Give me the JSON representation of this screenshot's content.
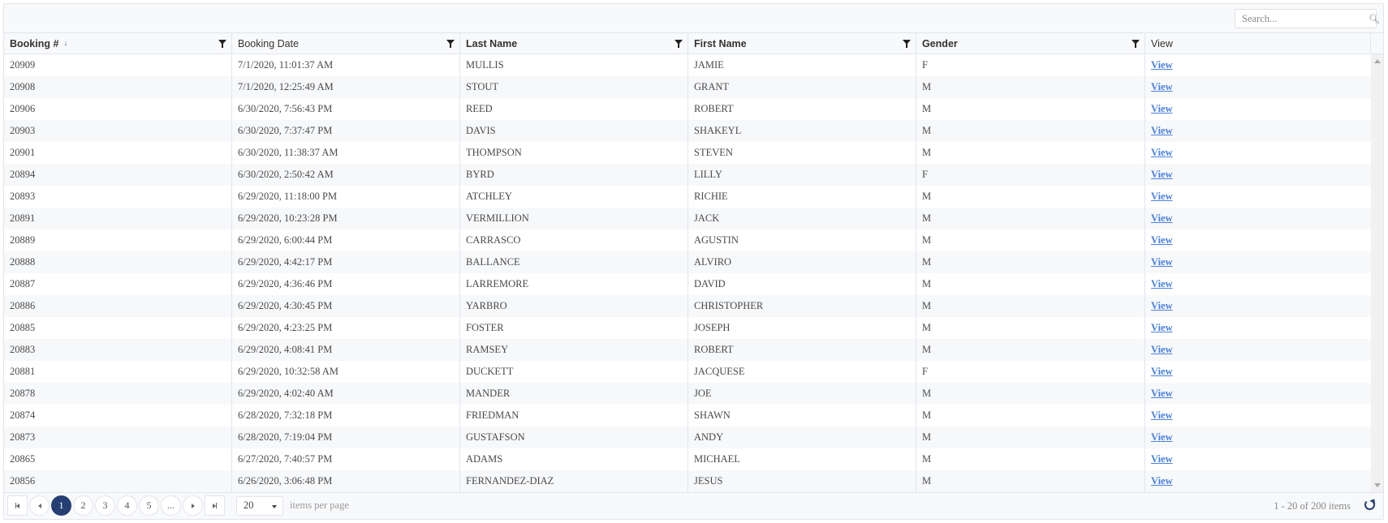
{
  "toolbar": {
    "search_placeholder": "Search...",
    "search_value": "",
    "search_icon": "search-icon"
  },
  "columns": [
    {
      "label": "Booking #",
      "sorted": "descending",
      "filterable": true
    },
    {
      "label": "Booking Date",
      "filterable": true
    },
    {
      "label": "Last Name",
      "filterable": true
    },
    {
      "label": "First Name",
      "filterable": true
    },
    {
      "label": "Gender",
      "filterable": true
    },
    {
      "label": "View",
      "filterable": false
    }
  ],
  "sort_icon": "arrow-down-icon",
  "link_color": "#4a82e0",
  "rows": [
    {
      "booking": "20909",
      "date": "7/1/2020, 11:01:37 AM",
      "last": "MULLIS",
      "first": "JAMIE",
      "gender": "F",
      "view": "View"
    },
    {
      "booking": "20908",
      "date": "7/1/2020, 12:25:49 AM",
      "last": "STOUT",
      "first": "GRANT",
      "gender": "M",
      "view": "View"
    },
    {
      "booking": "20906",
      "date": "6/30/2020, 7:56:43 PM",
      "last": "REED",
      "first": "ROBERT",
      "gender": "M",
      "view": "View"
    },
    {
      "booking": "20903",
      "date": "6/30/2020, 7:37:47 PM",
      "last": "DAVIS",
      "first": "SHAKEYL",
      "gender": "M",
      "view": "View"
    },
    {
      "booking": "20901",
      "date": "6/30/2020, 11:38:37 AM",
      "last": "THOMPSON",
      "first": "STEVEN",
      "gender": "M",
      "view": "View"
    },
    {
      "booking": "20894",
      "date": "6/30/2020, 2:50:42 AM",
      "last": "BYRD",
      "first": "LILLY",
      "gender": "F",
      "view": "View"
    },
    {
      "booking": "20893",
      "date": "6/29/2020, 11:18:00 PM",
      "last": "ATCHLEY",
      "first": "RICHIE",
      "gender": "M",
      "view": "View"
    },
    {
      "booking": "20891",
      "date": "6/29/2020, 10:23:28 PM",
      "last": "VERMILLION",
      "first": "JACK",
      "gender": "M",
      "view": "View"
    },
    {
      "booking": "20889",
      "date": "6/29/2020, 6:00:44 PM",
      "last": "CARRASCO",
      "first": "AGUSTIN",
      "gender": "M",
      "view": "View"
    },
    {
      "booking": "20888",
      "date": "6/29/2020, 4:42:17 PM",
      "last": "BALLANCE",
      "first": "ALVIRO",
      "gender": "M",
      "view": "View"
    },
    {
      "booking": "20887",
      "date": "6/29/2020, 4:36:46 PM",
      "last": "LARREMORE",
      "first": "DAVID",
      "gender": "M",
      "view": "View"
    },
    {
      "booking": "20886",
      "date": "6/29/2020, 4:30:45 PM",
      "last": "YARBRO",
      "first": "CHRISTOPHER",
      "gender": "M",
      "view": "View"
    },
    {
      "booking": "20885",
      "date": "6/29/2020, 4:23:25 PM",
      "last": "FOSTER",
      "first": "JOSEPH",
      "gender": "M",
      "view": "View"
    },
    {
      "booking": "20883",
      "date": "6/29/2020, 4:08:41 PM",
      "last": "RAMSEY",
      "first": "ROBERT",
      "gender": "M",
      "view": "View"
    },
    {
      "booking": "20881",
      "date": "6/29/2020, 10:32:58 AM",
      "last": "DUCKETT",
      "first": "JACQUESE",
      "gender": "F",
      "view": "View"
    },
    {
      "booking": "20878",
      "date": "6/29/2020, 4:02:40 AM",
      "last": "MANDER",
      "first": "JOE",
      "gender": "M",
      "view": "View"
    },
    {
      "booking": "20874",
      "date": "6/28/2020, 7:32:18 PM",
      "last": "FRIEDMAN",
      "first": "SHAWN",
      "gender": "M",
      "view": "View"
    },
    {
      "booking": "20873",
      "date": "6/28/2020, 7:19:04 PM",
      "last": "GUSTAFSON",
      "first": "ANDY",
      "gender": "M",
      "view": "View"
    },
    {
      "booking": "20865",
      "date": "6/27/2020, 7:40:57 PM",
      "last": "ADAMS",
      "first": "MICHAEL",
      "gender": "M",
      "view": "View"
    },
    {
      "booking": "20856",
      "date": "6/26/2020, 3:06:48 PM",
      "last": "FERNANDEZ-DIAZ",
      "first": "JESUS",
      "gender": "M",
      "view": "View"
    }
  ],
  "pager": {
    "pages": [
      "1",
      "2",
      "3",
      "4",
      "5",
      "..."
    ],
    "current_page": "1",
    "page_size": "20",
    "page_size_label": "items per page",
    "info": "1 - 20 of 200 items",
    "active_color": "#253f73"
  }
}
